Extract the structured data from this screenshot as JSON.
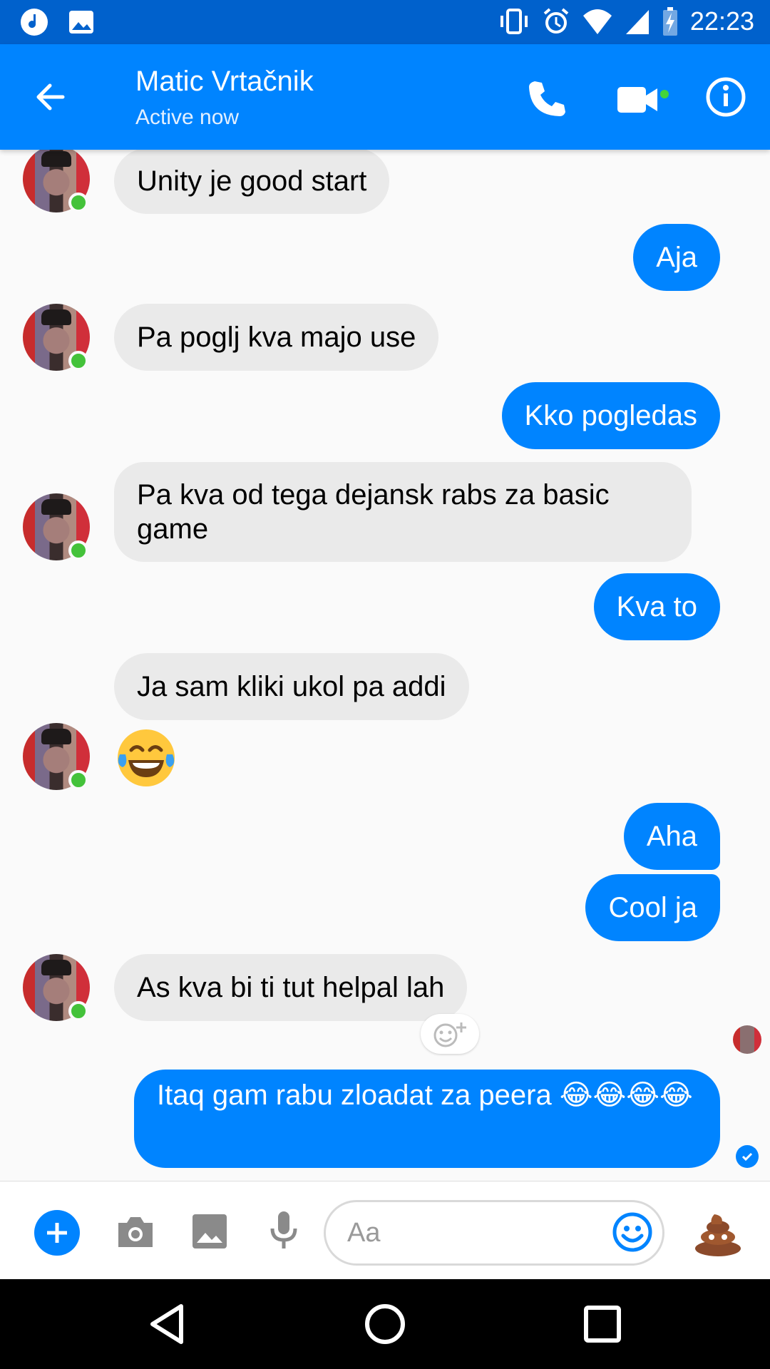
{
  "status_bar": {
    "time": "22:23",
    "left_icons": [
      "music-note-icon",
      "image-icon"
    ],
    "right_icons": [
      "vibrate-icon",
      "alarm-icon",
      "wifi-icon",
      "cell-signal-icon",
      "battery-charging-icon"
    ]
  },
  "header": {
    "contact_name": "Matic Vrtačnik",
    "contact_status": "Active now",
    "actions": [
      "back-icon",
      "phone-icon",
      "video-camera-icon",
      "info-icon"
    ]
  },
  "messages": [
    {
      "from": "contact",
      "text": "Unity je good start"
    },
    {
      "from": "me",
      "text": "Aja"
    },
    {
      "from": "contact",
      "text": "Pa poglj kva majo use"
    },
    {
      "from": "me",
      "text": "Kko pogledas"
    },
    {
      "from": "contact",
      "text": "Pa kva od tega dejansk rabs za basic game"
    },
    {
      "from": "me",
      "text": "Kva to"
    },
    {
      "from": "contact",
      "text": "Ja sam kliki ukol pa addi"
    },
    {
      "from": "contact",
      "text": "😂"
    },
    {
      "from": "me",
      "text": "Aha"
    },
    {
      "from": "me",
      "text": "Cool ja"
    },
    {
      "from": "contact",
      "text": "As kva bi ti tut helpal lah"
    },
    {
      "from": "me",
      "text": "Itaq gam rabu zloadat za peera 😂😂😂😂"
    }
  ],
  "composer": {
    "placeholder": "Aa",
    "buttons": [
      "plus-icon",
      "camera-icon",
      "gallery-icon",
      "microphone-icon",
      "emoji-icon",
      "poop-emoji-icon"
    ]
  },
  "colors": {
    "status_bar": "#0061cc",
    "brand": "#0084ff",
    "incoming_bubble": "#eaeaea",
    "online": "#44c23a"
  }
}
